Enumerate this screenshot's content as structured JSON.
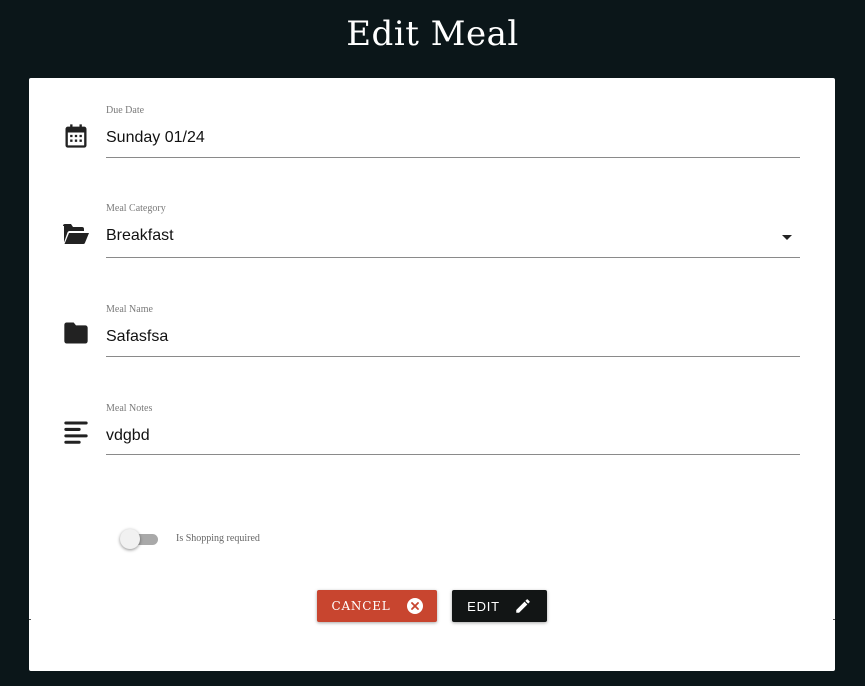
{
  "page": {
    "title": "Edit Meal"
  },
  "form": {
    "due_date": {
      "label": "Due Date",
      "value": "Sunday 01/24",
      "icon": "calendar-icon"
    },
    "meal_category": {
      "label": "Meal Category",
      "value": "Breakfast",
      "icon": "folder-open-icon"
    },
    "meal_name": {
      "label": "Meal Name",
      "value": "Safasfsa",
      "icon": "folder-icon"
    },
    "meal_notes": {
      "label": "Meal Notes",
      "value": "vdgbd",
      "icon": "notes-icon"
    },
    "shopping_required": {
      "label": "Is Shopping required",
      "checked": false
    }
  },
  "actions": {
    "cancel_label": "Cancel",
    "edit_label": "Edit",
    "cancel_color": "#c8452f",
    "edit_color": "#121515"
  },
  "colors": {
    "background": "#0b1619",
    "dialog": "#ffffff"
  }
}
